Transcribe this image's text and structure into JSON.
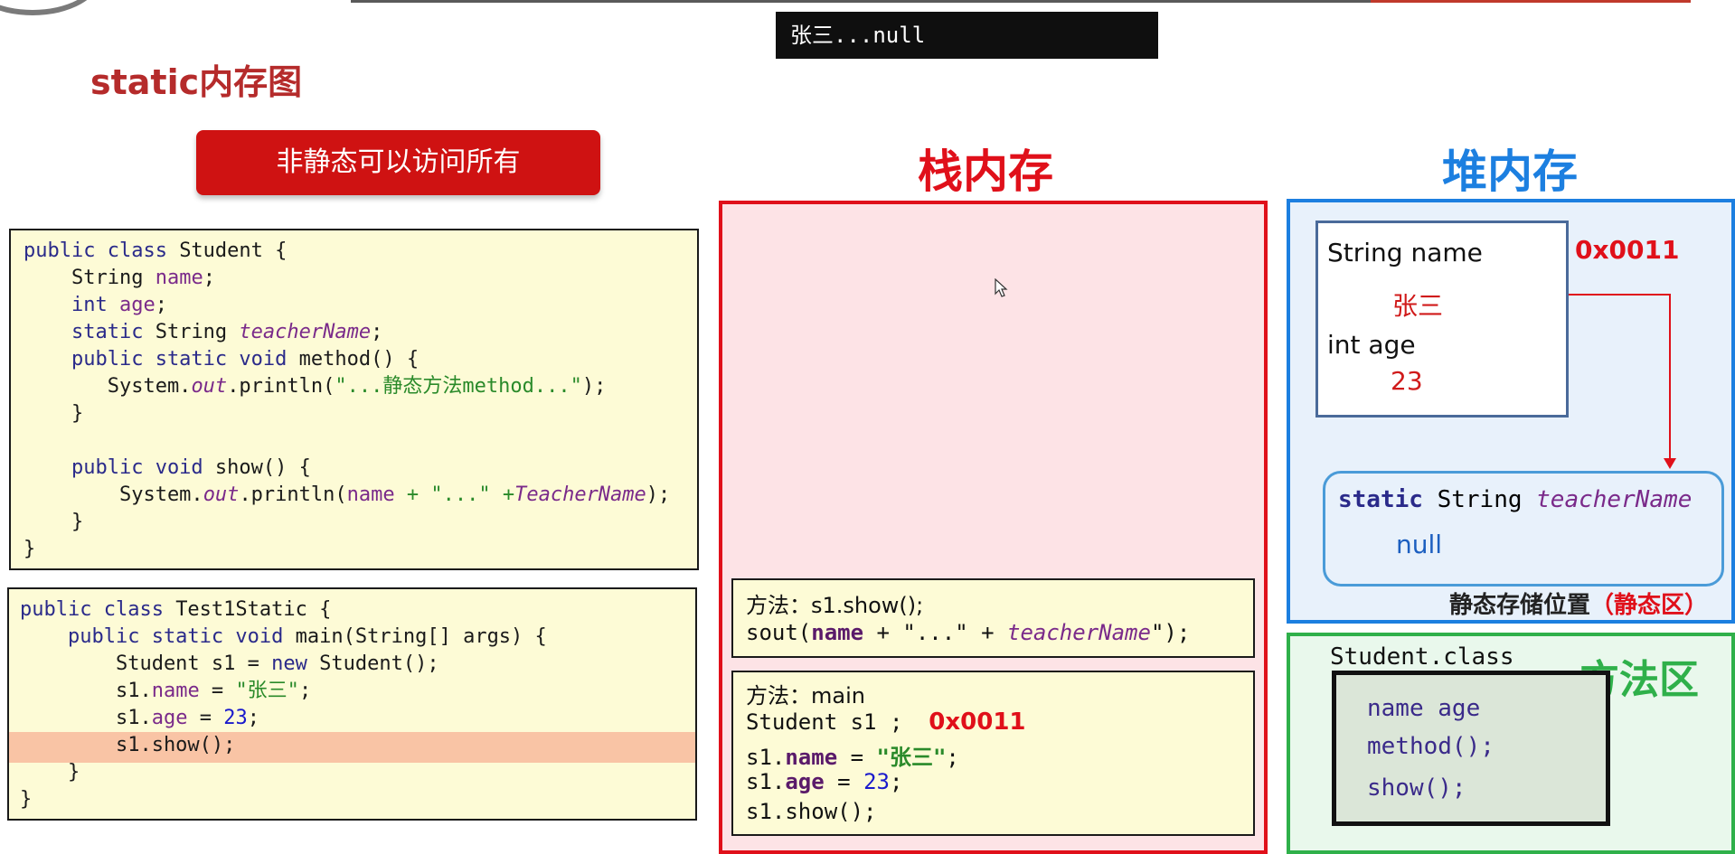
{
  "console": {
    "output": "张三...null"
  },
  "slide": {
    "title": "static内存图",
    "badge": "非静态可以访问所有"
  },
  "code_student": [
    [
      [
        "kw",
        "public class "
      ],
      [
        "",
        "Student {"
      ]
    ],
    [
      [
        "",
        "    String "
      ],
      [
        "fld",
        "name"
      ],
      [
        "",
        ";"
      ]
    ],
    [
      [
        "kw",
        "    int "
      ],
      [
        "fld",
        "age"
      ],
      [
        "",
        ";"
      ]
    ],
    [
      [
        "kw",
        "    static "
      ],
      [
        "",
        "String "
      ],
      [
        "ital",
        "teacherName"
      ],
      [
        "",
        ";"
      ]
    ],
    [
      [
        "kw",
        "    public static void "
      ],
      [
        "",
        "method() {"
      ]
    ],
    [
      [
        "",
        "       System."
      ],
      [
        "ital",
        "out"
      ],
      [
        "",
        ".println("
      ],
      [
        "str",
        "\"...静态方法method...\""
      ],
      [
        "",
        ");"
      ]
    ],
    [
      [
        "",
        "    }"
      ]
    ],
    [
      [
        "",
        ""
      ]
    ],
    [
      [
        "kw",
        "    public void "
      ],
      [
        "",
        "show() {"
      ]
    ],
    [
      [
        "",
        "        System."
      ],
      [
        "ital",
        "out"
      ],
      [
        "",
        ".println("
      ],
      [
        "fld",
        "name"
      ],
      [
        "str",
        " + \"...\" +"
      ],
      [
        "ital",
        "TeacherName"
      ],
      [
        "",
        ");"
      ]
    ],
    [
      [
        "",
        "    }"
      ]
    ],
    [
      [
        "",
        "}"
      ]
    ]
  ],
  "code_test": [
    [
      [
        "kw",
        "public class "
      ],
      [
        "",
        "Test1Static {"
      ]
    ],
    [
      [
        "kw",
        "    public static void "
      ],
      [
        "",
        "main(String[] args) {"
      ]
    ],
    [
      [
        "",
        "        Student s1 = "
      ],
      [
        "kw",
        "new "
      ],
      [
        "",
        "Student();"
      ]
    ],
    [
      [
        "",
        "        s1."
      ],
      [
        "fld",
        "name"
      ],
      [
        "",
        " = "
      ],
      [
        "str",
        "\"张三\""
      ],
      [
        "",
        ";"
      ]
    ],
    [
      [
        "",
        "        s1."
      ],
      [
        "fld",
        "age"
      ],
      [
        "",
        " = "
      ],
      [
        "num",
        "23"
      ],
      [
        "",
        ";"
      ]
    ],
    [
      [
        "",
        "        s1.show();"
      ]
    ],
    [
      [
        "",
        "    }"
      ]
    ],
    [
      [
        "",
        "}"
      ]
    ]
  ],
  "stack": {
    "title": "栈内存",
    "frame_show": {
      "label": "方法：s1.show();",
      "code_prefix": "sout(",
      "name": "name",
      "mid": " + \"...\" + ",
      "teacher": "teacherName",
      "suffix": "\");"
    },
    "frame_main": {
      "label": "方法：main",
      "line1": "Student s1 ;",
      "addr": "0x0011",
      "line2_prefix": "s1.",
      "line2_field": "name",
      "line2_eq": " = ",
      "line2_val": "\"张三\"",
      "line2_end": ";",
      "line3_prefix": "s1.",
      "line3_field": "age",
      "line3_eq": " = ",
      "line3_val": "23",
      "line3_end": ";",
      "line4": "s1.show();"
    }
  },
  "heap": {
    "title": "堆内存",
    "object": {
      "name_label": "String name",
      "name_value": "张三",
      "age_label": "int age",
      "age_value": "23"
    },
    "address": "0x0011",
    "static_kw": "static",
    "static_type": " String ",
    "static_field": "teacherName",
    "static_value": "null",
    "static_area_label": "静态存储位置",
    "static_area_paren": "（静态区）"
  },
  "method_area": {
    "title": "方法区",
    "class_name": "Student.class",
    "items": [
      "name  age",
      "method();",
      "show();"
    ]
  },
  "colors": {
    "stack": "#e0101a",
    "heap": "#1c7fe0",
    "method": "#2fb04a",
    "badge": "#cf1212"
  }
}
